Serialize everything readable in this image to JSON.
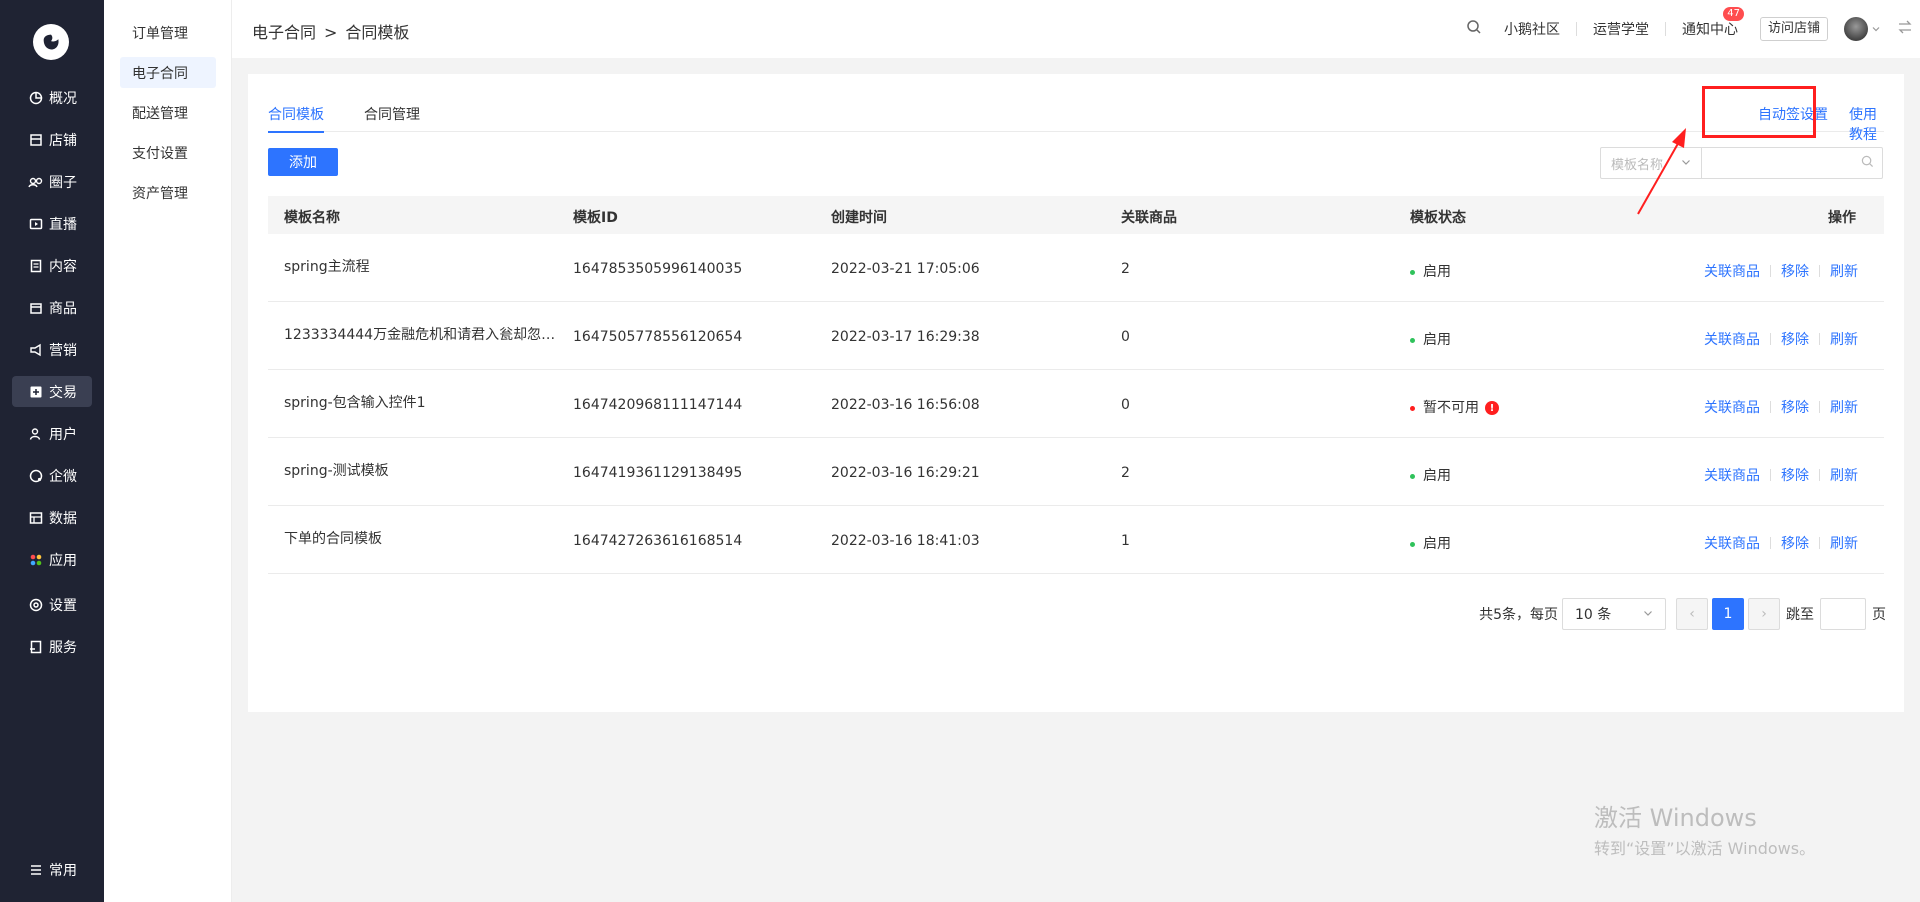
{
  "sidebar": {
    "items": [
      {
        "label": "概况",
        "icon": "chart-pie-icon"
      },
      {
        "label": "店铺",
        "icon": "store-icon"
      },
      {
        "label": "圈子",
        "icon": "group-icon"
      },
      {
        "label": "直播",
        "icon": "live-icon"
      },
      {
        "label": "内容",
        "icon": "document-icon"
      },
      {
        "label": "商品",
        "icon": "goods-icon"
      },
      {
        "label": "营销",
        "icon": "marketing-icon"
      },
      {
        "label": "交易",
        "icon": "trade-icon"
      },
      {
        "label": "用户",
        "icon": "user-icon"
      },
      {
        "label": "企微",
        "icon": "wecom-icon"
      },
      {
        "label": "数据",
        "icon": "data-icon"
      },
      {
        "label": "应用",
        "icon": "apps-icon"
      }
    ],
    "settings": "设置",
    "service": "服务",
    "common": "常用"
  },
  "submenu": [
    "订单管理",
    "电子合同",
    "配送管理",
    "支付设置",
    "资产管理"
  ],
  "header": {
    "crumb_parent": "电子合同",
    "crumb_sep": ">",
    "crumb_current": "合同模板",
    "community": "小鹅社区",
    "academy": "运营学堂",
    "notice": "通知中心",
    "notice_count": "47",
    "visit_store": "访问店铺"
  },
  "tabs": [
    "合同模板",
    "合同管理"
  ],
  "top_links": {
    "auto_sign": "自动签设置",
    "tutorial": "使用教程"
  },
  "add_label": "添加",
  "search": {
    "select_placeholder": "模板名称"
  },
  "table": {
    "headers": [
      "模板名称",
      "模板ID",
      "创建时间",
      "关联商品",
      "模板状态",
      "操作"
    ],
    "rows": [
      {
        "name": "spring主流程",
        "id": "1647853505996140035",
        "time": "2022-03-21 17:05:06",
        "goods": "2",
        "status": "启用",
        "ok": true
      },
      {
        "name": "1233334444万金融危机和请君入瓮却忽然...",
        "id": "1647505778556120654",
        "time": "2022-03-17 16:29:38",
        "goods": "0",
        "status": "启用",
        "ok": true
      },
      {
        "name": "spring-包含输入控件1",
        "id": "1647420968111147144",
        "time": "2022-03-16 16:56:08",
        "goods": "0",
        "status": "暂不可用",
        "ok": false
      },
      {
        "name": "spring-测试模板",
        "id": "1647419361129138495",
        "time": "2022-03-16 16:29:21",
        "goods": "2",
        "status": "启用",
        "ok": true
      },
      {
        "name": "下单的合同模板",
        "id": "1647427263616168514",
        "time": "2022-03-16 18:41:03",
        "goods": "1",
        "status": "启用",
        "ok": true
      }
    ],
    "ops": [
      "关联商品",
      "移除",
      "刷新"
    ]
  },
  "pager": {
    "total": "共5条，每页",
    "size": "10 条",
    "page": "1",
    "jump": "跳至",
    "page_unit": "页"
  },
  "watermark": {
    "line1": "激活 Windows",
    "line2": "转到“设置”以激活 Windows。"
  },
  "colors": {
    "primary": "#2d74ff",
    "ok": "#2fc25b",
    "error": "#ff1f1f",
    "sidebar": "#1f2333"
  }
}
